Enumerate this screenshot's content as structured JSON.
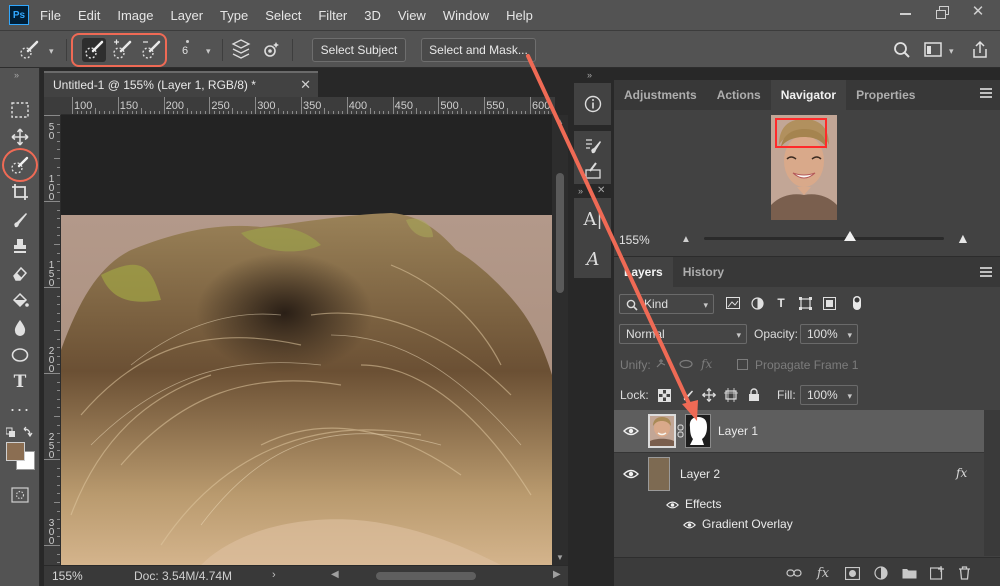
{
  "app": {
    "logo": "Ps"
  },
  "menu": [
    "File",
    "Edit",
    "Image",
    "Layer",
    "Type",
    "Select",
    "Filter",
    "3D",
    "View",
    "Window",
    "Help"
  ],
  "options": {
    "brush_size": "6",
    "select_subject": "Select Subject",
    "select_and_mask": "Select and Mask..."
  },
  "document": {
    "tab_title": "Untitled-1 @ 155% (Layer 1, RGB/8) *",
    "ruler_h": [
      "100",
      "150",
      "200",
      "250",
      "300",
      "350",
      "400",
      "450",
      "500",
      "550",
      "600"
    ],
    "ruler_v": [
      "5",
      "0",
      "1",
      "0",
      "0",
      "1",
      "5",
      "0",
      "2",
      "0",
      "0",
      "2",
      "5",
      "0",
      "3",
      "0",
      "0"
    ],
    "zoom": "155%",
    "doc_size": "Doc: 3.54M/4.74M"
  },
  "nav_panel": {
    "tabs": [
      "Adjustments",
      "Actions",
      "Navigator",
      "Properties"
    ],
    "active_tab": "Navigator",
    "zoom": "155%",
    "zoom_slider_fraction": 0.61
  },
  "layers_panel": {
    "tabs": [
      "Layers",
      "History"
    ],
    "active_tab": "Layers",
    "filter_kind": "Kind",
    "blend_mode": "Normal",
    "opacity_label": "Opacity:",
    "opacity": "100%",
    "unify_label": "Unify:",
    "propagate_label": "Propagate Frame 1",
    "lock_label": "Lock:",
    "fill_label": "Fill:",
    "fill": "100%",
    "layers": [
      {
        "name": "Layer 1",
        "selected": true,
        "thumb_color": "#b58b6a"
      },
      {
        "name": "Layer 2",
        "selected": false,
        "thumb_color": "#7d6a52",
        "fx": "fx"
      }
    ],
    "effects_label": "Effects",
    "effect_item": "Gradient Overlay"
  },
  "colors": {
    "foreground": "#8b6e52",
    "background": "#ffffff",
    "annotation": "#ef6a55"
  }
}
